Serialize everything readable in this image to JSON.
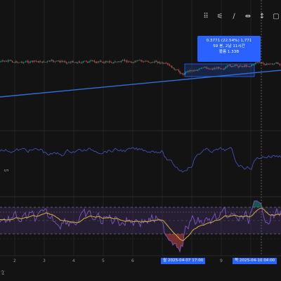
{
  "toolbar": {
    "tools": [
      {
        "name": "handle-icon",
        "glyph": "⠿"
      },
      {
        "name": "fib-fan-icon",
        "glyph": "⚟"
      },
      {
        "name": "trend-line-icon",
        "glyph": "∕"
      },
      {
        "name": "price-range-icon",
        "glyph": "⇹"
      },
      {
        "name": "date-range-icon",
        "glyph": "↕"
      },
      {
        "name": "rectangle-icon",
        "glyph": "▢"
      }
    ]
  },
  "measure_tooltip": {
    "line1": "0.3771 (22.54%) 1,771",
    "line2": "59 봉, 2날 11시간",
    "line3": "볼륨 1.33B"
  },
  "x_axis": {
    "labels": [
      "2",
      "3",
      "4",
      "5",
      "6",
      "7",
      "8",
      "9",
      "10"
    ]
  },
  "crosshair_labels": {
    "left": "월 2025-04-07  17:00",
    "right": "목 2025-04-10  04:00"
  },
  "brand": "𝔗",
  "pane_marker": "ᔕ",
  "colors": {
    "background": "#131313",
    "up": "#26a69a",
    "down": "#ef5350",
    "trendline": "#2f6fd6",
    "indicator": "#3f51b5",
    "rsi": "#7e57c2",
    "rsi_ma": "#d4b13f",
    "measure": "#2962ff"
  }
}
